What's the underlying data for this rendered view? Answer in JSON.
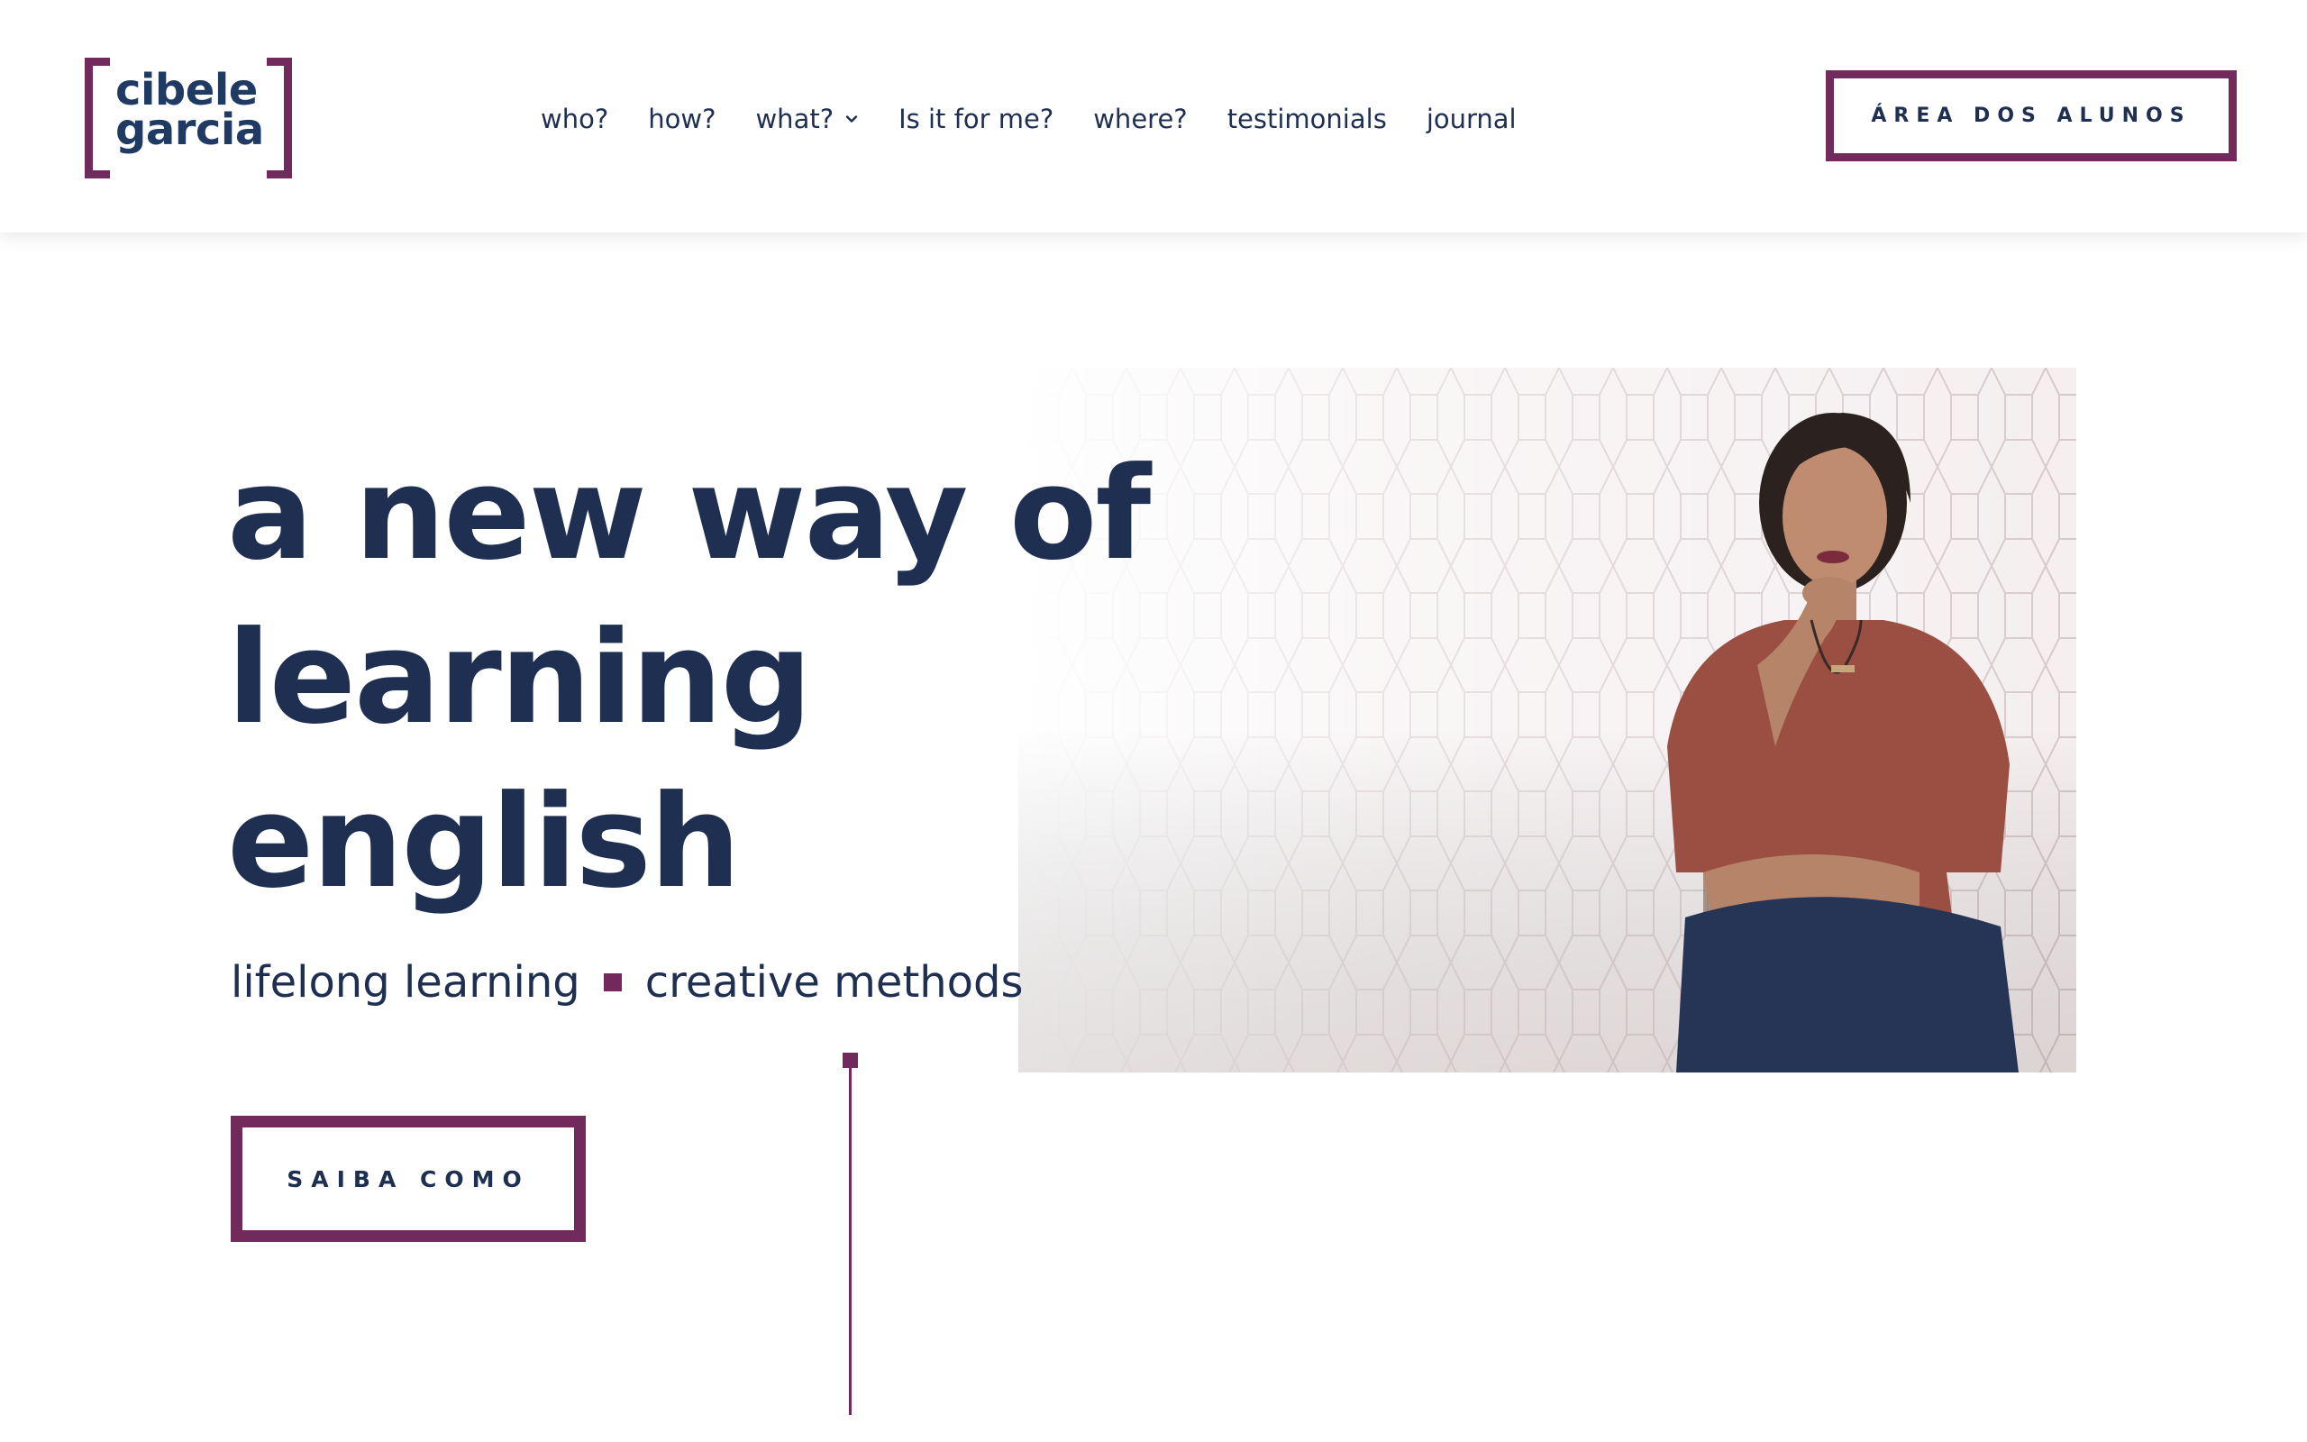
{
  "brand": {
    "line1": "cibele",
    "line2": "garcia",
    "accent_color": "#722a5c",
    "text_color": "#1f2f52"
  },
  "nav": {
    "items": [
      {
        "label": "who?"
      },
      {
        "label": "how?"
      },
      {
        "label": "what?",
        "has_dropdown": true,
        "icon": "chevron-down-icon"
      },
      {
        "label": "Is it for me?"
      },
      {
        "label": "where?"
      },
      {
        "label": "testimonials"
      },
      {
        "label": "journal"
      }
    ]
  },
  "header": {
    "students_area_label": "ÁREA DOS ALUNOS"
  },
  "hero": {
    "title_lines": [
      "a new way of",
      "learning",
      "english"
    ],
    "tagline_left": "lifelong learning",
    "tagline_right": "creative methods",
    "cta_label": "SAIBA COMO",
    "photo_subject": "woman-seated-portrait"
  }
}
